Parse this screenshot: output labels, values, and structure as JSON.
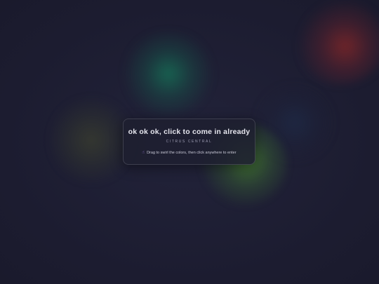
{
  "card": {
    "title": "ok ok ok, click to come in already",
    "subtitle": "CITRUS CENTRAL",
    "hint": "Drag to swirl the colors, then click anywhere to enter",
    "hint_icon": "pointing-hand-icon"
  },
  "colors": {
    "background": "#1e1e32",
    "card_background": "#1e1f30",
    "title_text": "#e6e6ee",
    "blob_teal": "#16785a",
    "blob_red": "#8c2828",
    "blob_green": "#509632",
    "blob_olive": "#464b2d",
    "blob_navy": "#1e2d4b"
  }
}
